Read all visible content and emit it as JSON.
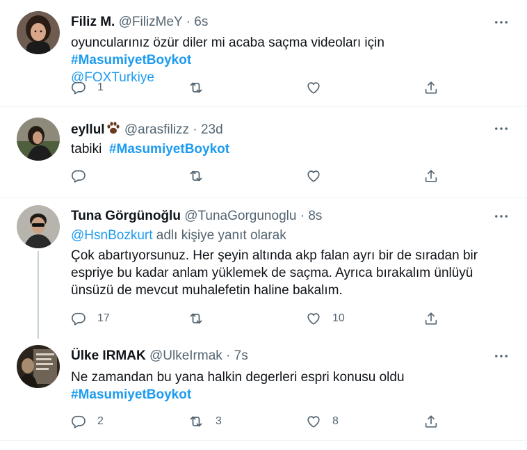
{
  "tweets": [
    {
      "name": "Filiz M.",
      "handle": "@FilizMeY",
      "separator": "·",
      "time": "6s",
      "text_prefix": "oyuncularınız özür diler mi acaba saçma videoları için",
      "hashtag": "#MasumiyetBoykot",
      "mention": "@FOXTurkiye",
      "reply_count": "1",
      "retweet_count": "",
      "like_count": ""
    },
    {
      "name": "eyllul",
      "handle": "@arasfilizz",
      "separator": "·",
      "time": "23d",
      "text_prefix": "tabiki",
      "hashtag": "#MasumiyetBoykot",
      "reply_count": "",
      "retweet_count": "",
      "like_count": ""
    },
    {
      "name": "Tuna Görgünoğlu",
      "handle": "@TunaGorgunoglu",
      "separator": "·",
      "time": "8s",
      "reply_to_mention": "@HsnBozkurt",
      "reply_to_suffix": "adlı kişiye yanıt olarak",
      "text": "Çok abartıyorsunuz. Her şeyin altında akp falan ayrı bir de sıradan bir espriye bu kadar anlam yüklemek de saçma. Ayrıca bırakalım ünlüyü ünsüzü de mevcut muhalefetin haline bakalım.",
      "reply_count": "17",
      "retweet_count": "",
      "like_count": "10"
    },
    {
      "name": "Ülke IRMAK",
      "handle": "@UlkeIrmak",
      "separator": "·",
      "time": "7s",
      "text": "Ne zamandan bu yana halkin degerleri espri konusu oldu",
      "hashtag": "#MasumiyetBoykot",
      "reply_count": "2",
      "retweet_count": "3",
      "like_count": "8"
    }
  ],
  "icons": {
    "reply": "reply-icon",
    "retweet": "retweet-icon",
    "like": "like-icon",
    "share": "share-icon",
    "more": "more-icon",
    "paw": "paw-icon"
  },
  "colors": {
    "link": "#1d9bf0",
    "secondary_text": "#536471",
    "primary_text": "#0f1419",
    "divider": "#eff3f4",
    "thread_line": "#c4cfd6"
  }
}
